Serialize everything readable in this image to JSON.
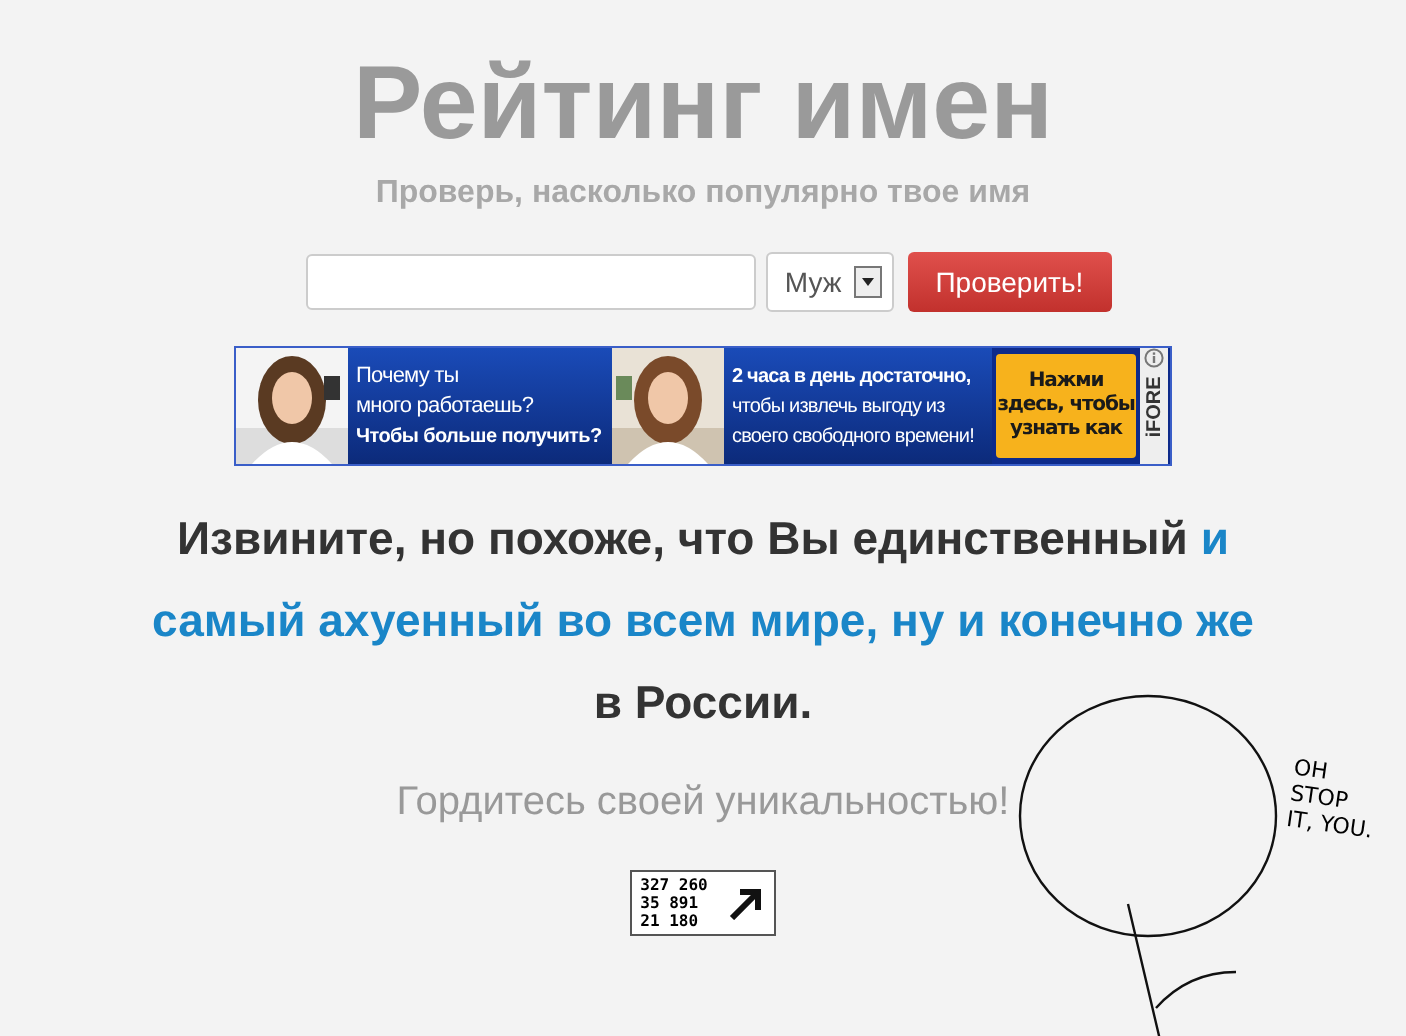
{
  "header": {
    "title": "Рейтинг имен",
    "subtitle": "Проверь, насколько популярно твое имя"
  },
  "form": {
    "gender_select": {
      "value": "Муж"
    },
    "submit_button": "Проверить!"
  },
  "ad_banner": {
    "left_text": [
      "Почему ты",
      "много работаешь?"
    ],
    "left_bold": "Чтобы больше получить?",
    "middle_bold": "2 часа в день  достаточно,",
    "middle_text": [
      "чтобы извлечь выгоду из",
      "своего свободного времени!"
    ],
    "cta": "Нажми здесь, чтобы узнать как",
    "brand": "iFORE"
  },
  "message": [
    {
      "text": "Извините, но похоже, что Вы единственный ",
      "highlight": false
    },
    {
      "text": "и самый ахуенный во всем мире, ну и конечно же",
      "highlight": true
    },
    {
      "text": " в России.",
      "highlight": false
    }
  ],
  "tagline": "Гордитесь своей уникальностью!",
  "counter": [
    "327 260",
    "35 891",
    "21 180"
  ],
  "meme": {
    "speech": [
      "OH",
      "STOP",
      "IT, YOU."
    ]
  }
}
